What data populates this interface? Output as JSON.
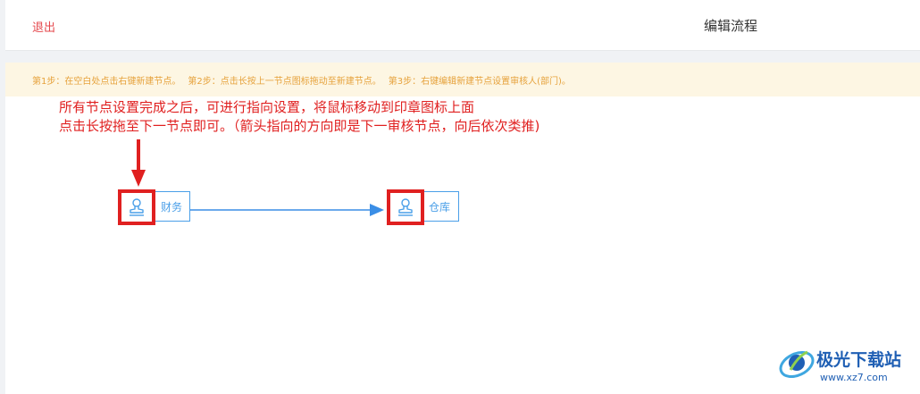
{
  "header": {
    "exit_label": "退出",
    "title": "编辑流程"
  },
  "tips": {
    "step1": "第1步：在空白处点击右键新建节点。",
    "step2": "第2步：点击长按上一节点图标拖动至新建节点。",
    "step3": "第3步：右键编辑新建节点设置审核人(部门)。"
  },
  "annotation": {
    "line1": "所有节点设置完成之后，可进行指向设置，将鼠标移动到印章图标上面",
    "line2": "点击长按拖至下一节点即可。（箭头指向的方向即是下一审核节点，向后依次类推)"
  },
  "nodes": [
    {
      "label": "财务",
      "icon": "stamp-icon"
    },
    {
      "label": "仓库",
      "icon": "stamp-icon"
    }
  ],
  "watermark": {
    "brand": "极光下载站",
    "url": "www.xz7.com"
  },
  "colors": {
    "exit": "#e5484d",
    "tip_text": "#e6a23c",
    "tip_bg": "#fdf6e3",
    "annotation": "#e02020",
    "node_border": "#4a9fe8",
    "connector": "#3a8ee6",
    "highlight": "#e02020"
  }
}
